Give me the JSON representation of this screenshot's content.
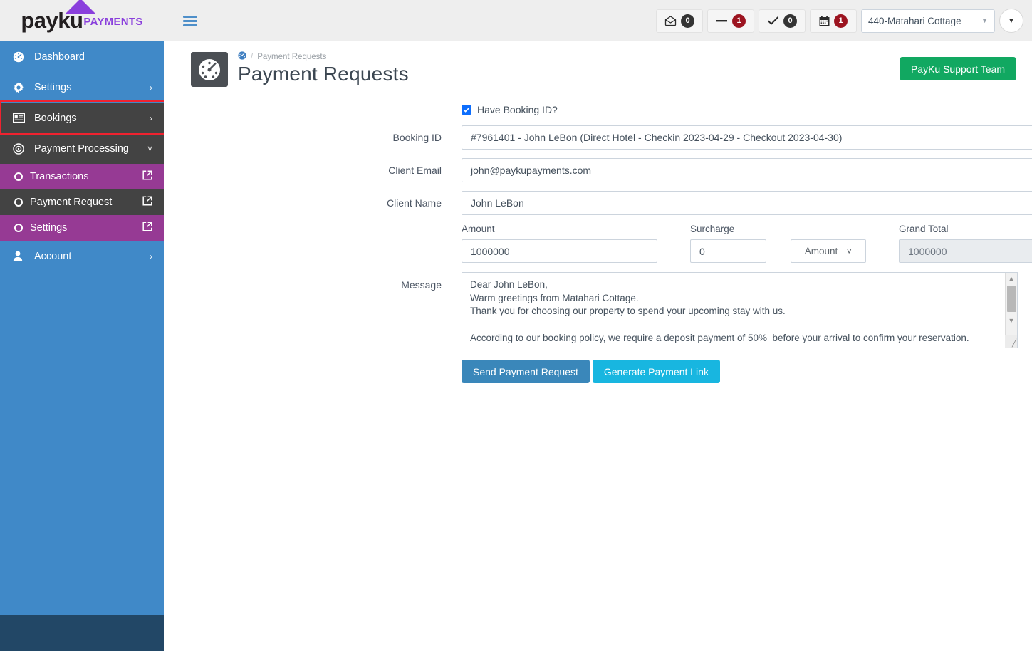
{
  "brand": {
    "name": "payku",
    "suffix": "PAYMENTS",
    "accent": "#8a3fdc"
  },
  "topbar": {
    "menu_icon": "hamburger-icon",
    "chips": [
      {
        "icon": "envelope-open-icon",
        "count": "0",
        "style": "dark"
      },
      {
        "icon": "minus-icon",
        "count": "1",
        "style": "red"
      },
      {
        "icon": "check-icon",
        "count": "0",
        "style": "dark"
      },
      {
        "icon": "calendar-icon",
        "count": "1",
        "style": "red"
      }
    ],
    "property_select": {
      "value": "440-Matahari Cottage"
    },
    "user_menu": {
      "icon": "caret-down-icon"
    }
  },
  "sidebar": {
    "items": [
      {
        "label": "Dashboard",
        "icon": "speedometer-icon",
        "arrow": "",
        "state": "blue"
      },
      {
        "label": "Settings",
        "icon": "gear-icon",
        "arrow": "›",
        "state": "blue"
      },
      {
        "label": "Bookings",
        "icon": "id-card-icon",
        "arrow": "›",
        "state": "dark"
      },
      {
        "label": "Payment Processing",
        "icon": "target-icon",
        "arrow": "˅",
        "state": "dark"
      }
    ],
    "submenu": [
      {
        "label": "Transactions",
        "icon": "circle-icon",
        "ext": "external-link-icon",
        "state": "purple"
      },
      {
        "label": "Payment Request",
        "icon": "circle-icon",
        "ext": "external-link-icon",
        "state": "active"
      },
      {
        "label": "Settings",
        "icon": "circle-icon",
        "ext": "external-link-icon",
        "state": "purple"
      }
    ],
    "account": {
      "label": "Account",
      "icon": "user-icon",
      "arrow": "›"
    },
    "colors": {
      "blue": "#4089c8",
      "dark": "#434343",
      "purple": "#963a94",
      "footer": "#224766",
      "highlight": "#f0222f"
    }
  },
  "page": {
    "icon": "speedometer-tile-icon",
    "breadcrumb_home_icon": "dashboard-icon",
    "breadcrumb_sep": "/",
    "breadcrumb_current": "Payment Requests",
    "title": "Payment Requests",
    "support_button": "PayKu Support Team",
    "support_color": "#11a861"
  },
  "form": {
    "have_booking_id": {
      "label": "Have Booking ID?",
      "checked": true
    },
    "booking_id": {
      "label": "Booking ID",
      "value": "#7961401 - John LeBon (Direct Hotel - Checkin 2023-04-29 - Checkout 2023-04-30)"
    },
    "client_email": {
      "label": "Client Email",
      "value": "john@paykupayments.com"
    },
    "client_name": {
      "label": "Client Name",
      "value": "John LeBon"
    },
    "amount": {
      "label": "Amount",
      "value": "1000000"
    },
    "surcharge": {
      "label": "Surcharge",
      "value": "0"
    },
    "surcharge_unit": {
      "value": "Amount",
      "caret": "˅"
    },
    "grand_total": {
      "label": "Grand Total",
      "value": "1000000",
      "readonly": true
    },
    "message": {
      "label": "Message",
      "value": "Dear John LeBon,\nWarm greetings from Matahari Cottage.\nThank you for choosing our property to spend your upcoming stay with us.\n\nAccording to our booking policy, we require a deposit payment of 50%  before your arrival to confirm your reservation."
    },
    "buttons": {
      "send": {
        "label": "Send Payment Request",
        "color": "#3a87ba"
      },
      "generate": {
        "label": "Generate Payment Link",
        "color": "#18b6e0"
      }
    }
  }
}
